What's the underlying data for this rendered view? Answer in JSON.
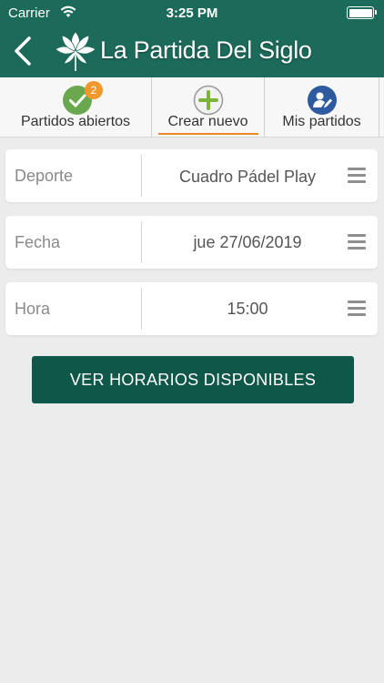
{
  "status_bar": {
    "carrier": "Carrier",
    "time": "3:25 PM"
  },
  "header": {
    "title": "La Partida Del Siglo",
    "background_color": "#1c6a5a"
  },
  "tabs": [
    {
      "label": "Partidos abiertos",
      "icon": "check-circle-icon",
      "badge": "2",
      "icon_color": "#6aa84f"
    },
    {
      "label": "Crear nuevo",
      "icon": "plus-circle-icon",
      "active": true,
      "icon_color": "#7bb33b"
    },
    {
      "label": "Mis partidos",
      "icon": "user-edit-icon",
      "icon_color": "#2e5aa0"
    }
  ],
  "form": {
    "sport": {
      "label": "Deporte",
      "value": "Cuadro Pádel Play"
    },
    "date": {
      "label": "Fecha",
      "value": "jue 27/06/2019"
    },
    "time": {
      "label": "Hora",
      "value": "15:00"
    }
  },
  "cta": {
    "label": "VER HORARIOS DISPONIBLES",
    "color": "#0f5749"
  },
  "accent_color": "#e88a28"
}
